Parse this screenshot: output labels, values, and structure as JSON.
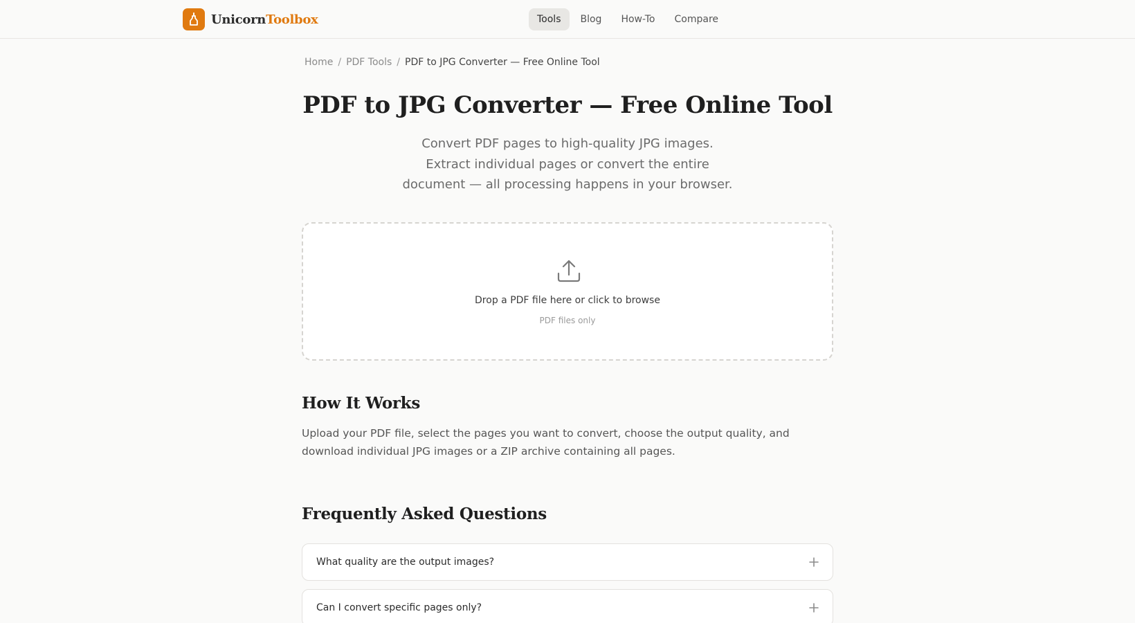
{
  "header": {
    "logo": {
      "text_part1": "Unicorn",
      "text_part2": "Toolbox",
      "icon": "unicorn-bottle-icon",
      "brand_color": "#e07a10"
    },
    "nav": [
      {
        "label": "Tools",
        "active": true
      },
      {
        "label": "Blog",
        "active": false
      },
      {
        "label": "How-To",
        "active": false
      },
      {
        "label": "Compare",
        "active": false
      }
    ]
  },
  "breadcrumb": {
    "items": [
      "Home",
      "PDF Tools"
    ],
    "separator": "/",
    "current": "PDF to JPG Converter — Free Online Tool"
  },
  "hero": {
    "title": "PDF to JPG Converter — Free Online Tool",
    "subtitle": "Convert PDF pages to high-quality JPG images. Extract individual pages or convert the entire document — all processing happens in your browser."
  },
  "dropzone": {
    "icon": "upload-icon",
    "main_text": "Drop a PDF file here or click to browse",
    "sub_text": "PDF files only"
  },
  "how_it_works": {
    "title": "How It Works",
    "text": "Upload your PDF file, select the pages you want to convert, choose the output quality, and download individual JPG images or a ZIP archive containing all pages."
  },
  "faq": {
    "title": "Frequently Asked Questions",
    "items": [
      {
        "question": "What quality are the output images?",
        "icon": "plus-icon"
      },
      {
        "question": "Can I convert specific pages only?",
        "icon": "plus-icon"
      }
    ]
  }
}
